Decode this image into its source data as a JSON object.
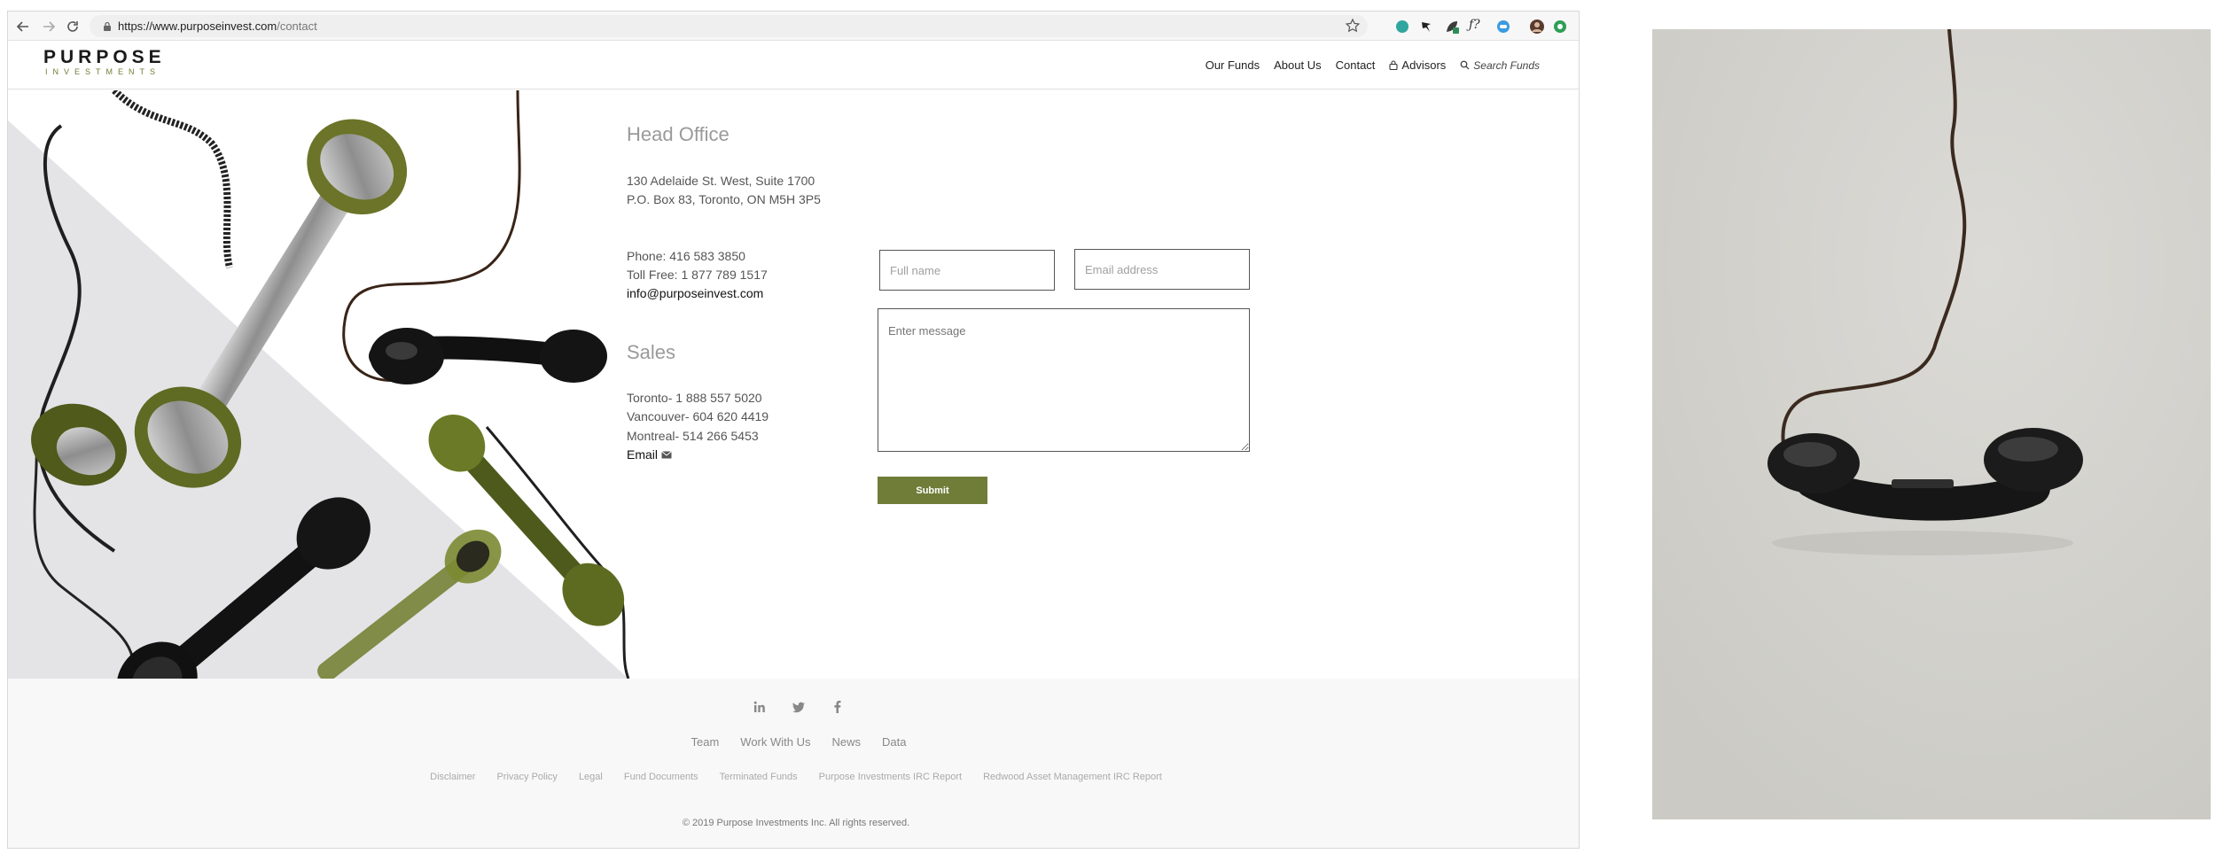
{
  "browser": {
    "url_host": "https://www.purposeinvest.com",
    "url_path": "/contact",
    "extension_icons": [
      "teal-circle-icon",
      "bird-icon",
      "leaf-icon",
      "formula-icon",
      "chat-bubble-icon",
      "avatar-icon",
      "green-badge-icon"
    ]
  },
  "header": {
    "logo_main": "PURPOSE",
    "logo_sub": "INVESTMENTS",
    "nav": [
      "Our Funds",
      "About Us",
      "Contact",
      "Advisors"
    ],
    "search_label": "Search Funds"
  },
  "head_office": {
    "title": "Head Office",
    "address_line1": "130 Adelaide St. West, Suite 1700",
    "address_line2": "P.O. Box 83, Toronto, ON M5H 3P5",
    "phone": "Phone: 416 583 3850",
    "toll_free": "Toll Free: 1 877 789 1517",
    "email": "info@purposeinvest.com"
  },
  "sales": {
    "title": "Sales",
    "toronto": "Toronto- 1 888 557 5020",
    "vancouver": "Vancouver- 604 620 4419",
    "montreal": "Montreal- 514 266 5453",
    "email_label": "Email"
  },
  "form": {
    "full_name_placeholder": "Full name",
    "email_placeholder": "Email address",
    "message_placeholder": "Enter message",
    "submit_label": "Submit"
  },
  "footer": {
    "social": [
      "linkedin-icon",
      "twitter-icon",
      "facebook-icon"
    ],
    "main_links": [
      "Team",
      "Work With Us",
      "News",
      "Data"
    ],
    "legal_links": [
      "Disclaimer",
      "Privacy Policy",
      "Legal",
      "Fund Documents",
      "Terminated Funds",
      "Purpose Investments IRC Report",
      "Redwood Asset Management IRC Report"
    ],
    "copyright": "© 2019 Purpose Investments Inc. All rights reserved."
  },
  "colors": {
    "brand_green": "#707d38",
    "photo_background": "#d3d2cd"
  }
}
